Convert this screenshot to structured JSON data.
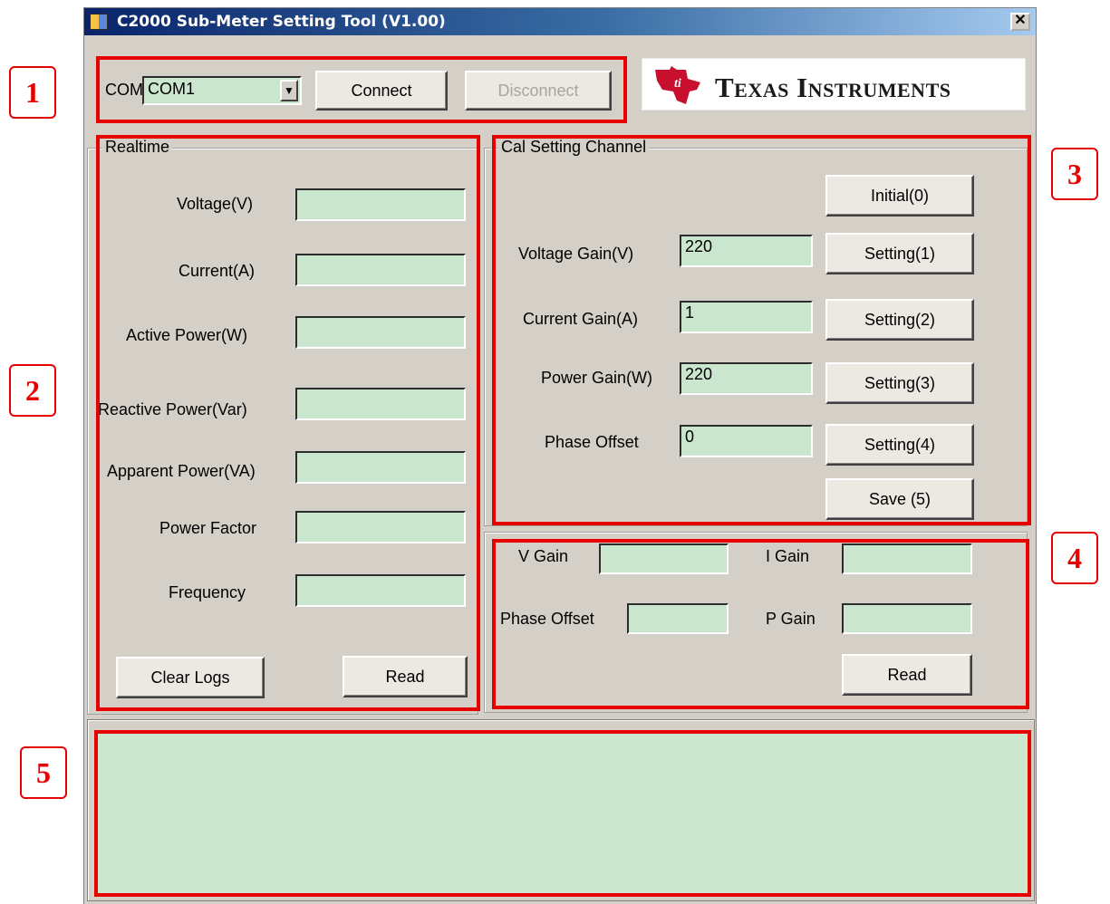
{
  "window": {
    "title": "C2000 Sub-Meter Setting Tool (V1.00)",
    "close_glyph": "✕"
  },
  "connection": {
    "com_label": "COM",
    "port_value": "COM1",
    "connect_label": "Connect",
    "disconnect_label": "Disconnect"
  },
  "logo": {
    "text": "Texas Instruments"
  },
  "realtime": {
    "title": "Realtime",
    "voltage_label": "Voltage(V)",
    "voltage_value": "",
    "current_label": "Current(A)",
    "current_value": "",
    "active_power_label": "Active Power(W)",
    "active_power_value": "",
    "reactive_power_label": "Reactive Power(Var)",
    "reactive_power_value": "",
    "apparent_power_label": "Apparent Power(VA)",
    "apparent_power_value": "",
    "power_factor_label": "Power Factor",
    "power_factor_value": "",
    "frequency_label": "Frequency",
    "frequency_value": "",
    "clear_logs_label": "Clear Logs",
    "read_label": "Read"
  },
  "cal_setting": {
    "title": "Cal Setting Channel",
    "initial_label": "Initial(0)",
    "voltage_gain_label": "Voltage Gain(V)",
    "voltage_gain_value": "220",
    "setting1_label": "Setting(1)",
    "current_gain_label": "Current Gain(A)",
    "current_gain_value": "1",
    "setting2_label": "Setting(2)",
    "power_gain_label": "Power Gain(W)",
    "power_gain_value": "220",
    "setting3_label": "Setting(3)",
    "phase_offset_label": "Phase Offset",
    "phase_offset_value": "0",
    "setting4_label": "Setting(4)",
    "save_label": "Save (5)"
  },
  "gain_readout": {
    "v_gain_label": "V Gain",
    "v_gain_value": "",
    "i_gain_label": "I Gain",
    "i_gain_value": "",
    "phase_offset_label": "Phase Offset",
    "phase_offset_value": "",
    "p_gain_label": "P Gain",
    "p_gain_value": "",
    "read_label": "Read"
  },
  "log": {
    "text": ""
  },
  "callouts": [
    "1",
    "2",
    "3",
    "4",
    "5"
  ],
  "colors": {
    "highlight": "#e60000",
    "field_bg": "#cae6cf",
    "window_bg": "#d4d0c8",
    "ti_red": "#c8102e"
  }
}
